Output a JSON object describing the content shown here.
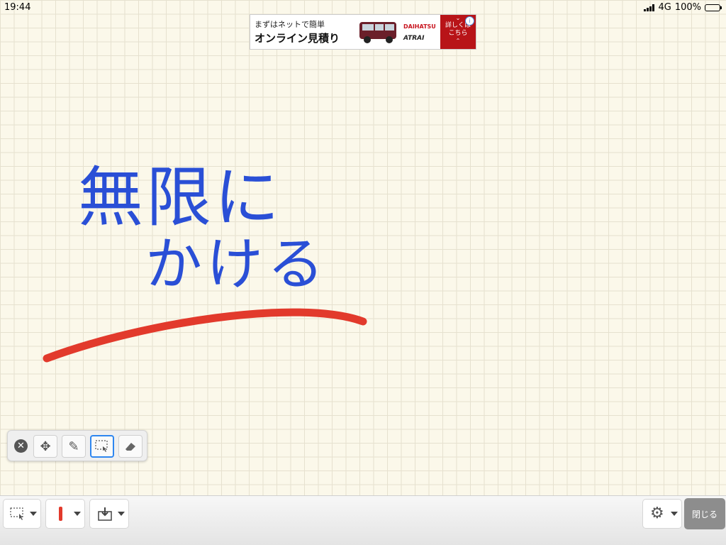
{
  "status": {
    "time": "19:44",
    "network": "4G",
    "battery": "100%"
  },
  "ad": {
    "line1": "まずはネットで簡単",
    "line2": "オンライン見積り",
    "brand": "DAIHATSU",
    "model": "ATRAI",
    "cta": "詳しくはこちら",
    "info": "i"
  },
  "canvas": {
    "handwriting_line1": "無限に",
    "handwriting_line2": "かける",
    "ink_color": "#2a4fd6",
    "stroke_color": "#e23a2c"
  },
  "palette": {
    "tools": [
      {
        "name": "close",
        "icon": "close-icon"
      },
      {
        "name": "move",
        "icon": "move-icon"
      },
      {
        "name": "pen",
        "icon": "pen-icon"
      },
      {
        "name": "select",
        "icon": "selection-icon",
        "active": true
      },
      {
        "name": "eraser",
        "icon": "eraser-icon"
      }
    ]
  },
  "toolbar": {
    "close_label": "閉じる",
    "pen_color": "#e23a2c",
    "accent": "#2e86f0"
  }
}
